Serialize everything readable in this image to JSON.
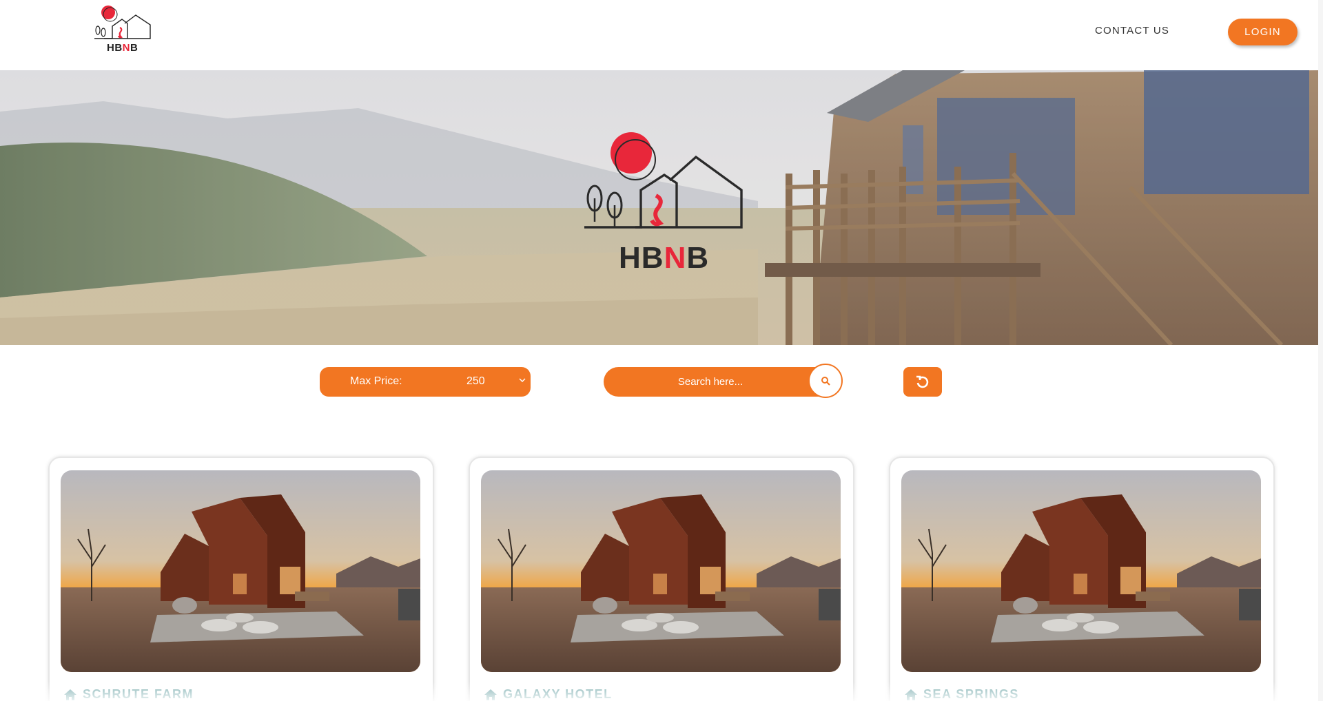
{
  "brand": {
    "name_prefix": "HB",
    "name_n": "N",
    "name_suffix": "B"
  },
  "header": {
    "contact_label": "CONTACT US",
    "login_label": "LOGIN"
  },
  "filters": {
    "price_label": "Max Price:",
    "price_value": "250",
    "search_placeholder": "Search here..."
  },
  "colors": {
    "accent": "#f27622",
    "title": "#7fb0b2",
    "logo_red": "#e8273a"
  },
  "icons": {
    "search": "search-icon",
    "reset": "reset-icon",
    "home": "home-icon",
    "chevron": "chevron-down-icon"
  },
  "places": [
    {
      "name": "SCHRUTE FARM"
    },
    {
      "name": "GALAXY HOTEL"
    },
    {
      "name": "SEA SPRINGS"
    }
  ]
}
